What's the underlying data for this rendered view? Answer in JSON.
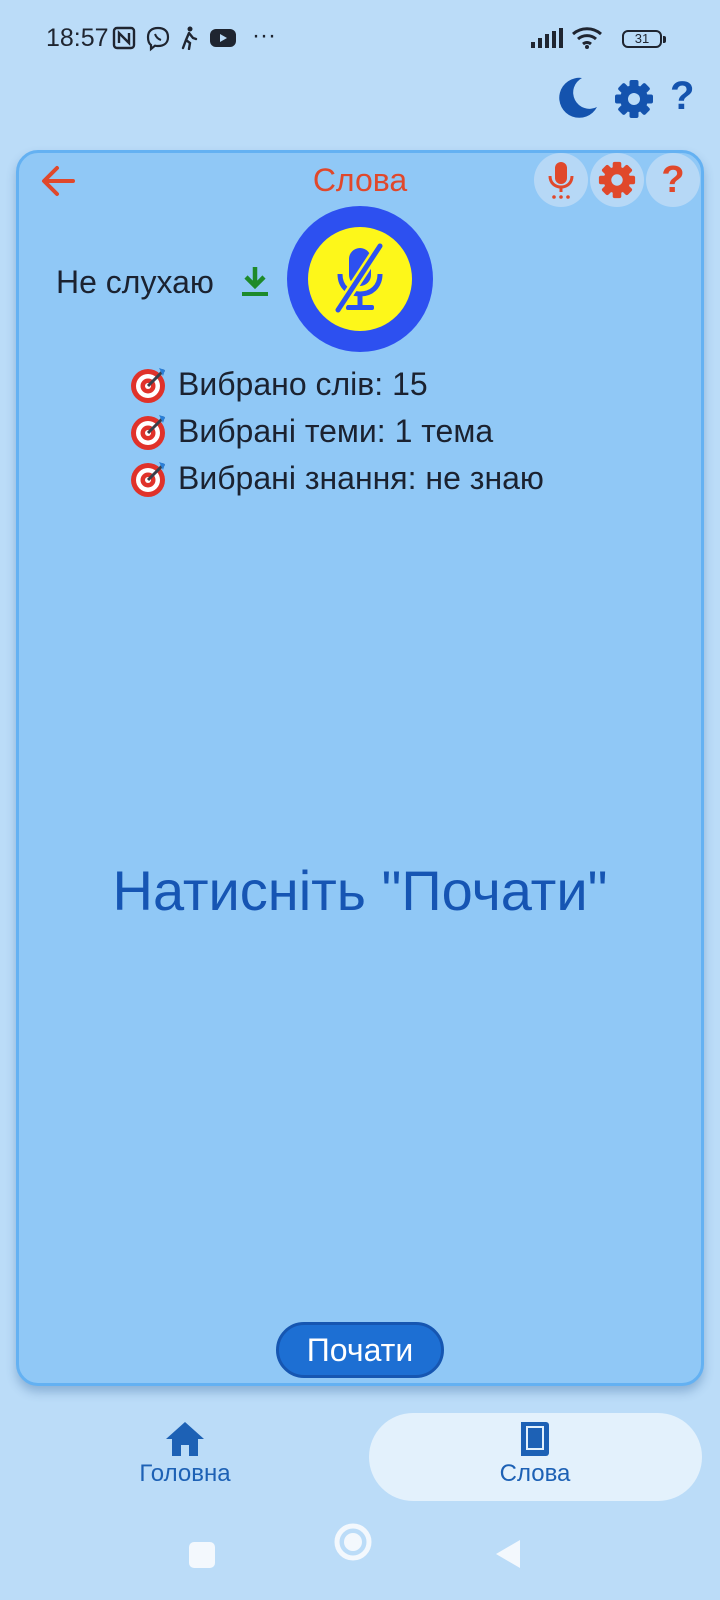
{
  "status_bar": {
    "time": "18:57",
    "battery": "31",
    "more": "···"
  },
  "top_actions": {
    "icons": [
      "moon-icon",
      "gear-icon",
      "help-icon"
    ],
    "help_glyph": "?"
  },
  "card": {
    "title": "Слова",
    "help_glyph": "?",
    "listening_label": "Не слухаю",
    "stats": [
      "Вибрано слів: 15",
      "Вибрані теми: 1 тема",
      "Вибрані знання: не знаю"
    ],
    "hint": "Натисніть \"Почати\"",
    "start_label": "Почати"
  },
  "bottom_nav": {
    "items": [
      {
        "label": "Головна",
        "icon": "home-icon"
      },
      {
        "label": "Слова",
        "icon": "book-icon",
        "active": true
      }
    ]
  },
  "colors": {
    "background": "#bbdcf8",
    "card": "#90c8f6",
    "accent_orange": "#e0482b",
    "primary_blue": "#1655b3",
    "mic_ring": "#2d50f0",
    "mic_fill": "#fdf71a"
  }
}
